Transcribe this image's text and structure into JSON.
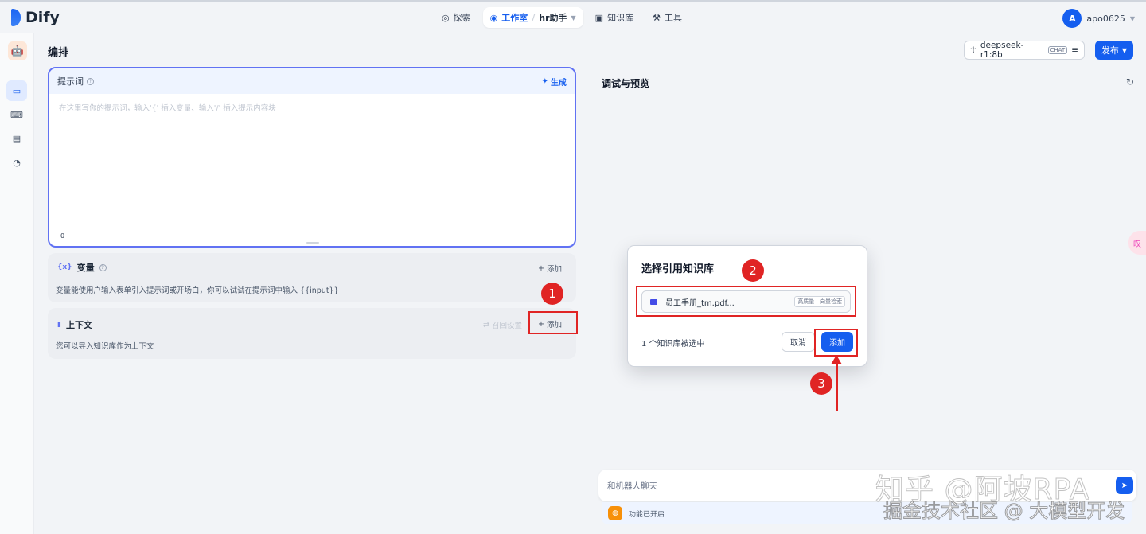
{
  "app": {
    "name": "Dify"
  },
  "nav": {
    "explore": "探索",
    "studio": "工作室",
    "current_app": "hr助手",
    "knowledge": "知识库",
    "tools": "工具"
  },
  "user": {
    "initial": "A",
    "name": "apo0625"
  },
  "page": {
    "title": "编排"
  },
  "model": {
    "name": "deepseek-r1:8b",
    "mode": "CHAT"
  },
  "publish": {
    "label": "发布"
  },
  "prompt": {
    "label": "提示词",
    "generate": "生成",
    "placeholder": "在这里写你的提示词，输入'{' 插入变量、输入'/' 插入提示内容块",
    "count": "0"
  },
  "variables": {
    "icon": "{x}",
    "title": "变量",
    "add": "添加",
    "desc": "变量能使用户输入表单引入提示词或开场白，你可以试试在提示词中输入 {{input}}"
  },
  "context": {
    "title": "上下文",
    "recall": "召回设置",
    "add": "添加",
    "desc": "您可以导入知识库作为上下文"
  },
  "preview": {
    "title": "调试与预览"
  },
  "dialog": {
    "title": "选择引用知识库",
    "kb_name": "员工手册_tm.pdf...",
    "kb_tag": "高质量 · 向量检索",
    "selected_count": "1 个知识库被选中",
    "cancel": "取消",
    "add": "添加"
  },
  "annotations": {
    "badge1": "1",
    "badge2": "2",
    "badge3": "3"
  },
  "chat": {
    "placeholder": "和机器人聊天"
  },
  "features": {
    "label": "功能已开启"
  },
  "side_float": {
    "label": "叹"
  },
  "watermark": {
    "line1": "知乎 @阿坡RPA",
    "line2": "掘金技术社区 @ 大模型开发"
  },
  "colors": {
    "primary": "#155eef",
    "annotation": "#e02424",
    "prompt_border": "#6172f3"
  }
}
